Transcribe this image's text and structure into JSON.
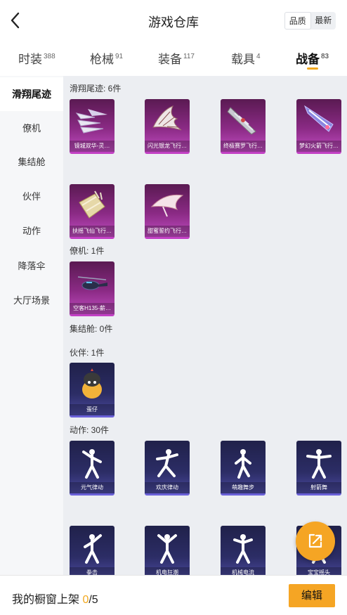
{
  "header": {
    "title": "游戏仓库",
    "sort_options": [
      "品质",
      "最新"
    ]
  },
  "tabs": [
    {
      "label": "时装",
      "count": "388"
    },
    {
      "label": "枪械",
      "count": "91"
    },
    {
      "label": "装备",
      "count": "117"
    },
    {
      "label": "载具",
      "count": "4"
    },
    {
      "label": "战备",
      "count": "83"
    }
  ],
  "sidebar": {
    "items": [
      "滑翔尾迹",
      "僚机",
      "集结舱",
      "伙伴",
      "动作",
      "降落伞",
      "大厅场景"
    ]
  },
  "sections": {
    "glide": {
      "label": "滑翔尾迹: 6件",
      "items": [
        "镜城双华-灵…",
        "闪光银龙飞行…",
        "终极赛罗飞行…",
        "梦幻火箭飞行…",
        "扶摇飞仙飞行…",
        "甜蜜誓约飞行…"
      ]
    },
    "wingman": {
      "label": "僚机: 1件",
      "items": [
        "空客H135-薪…"
      ]
    },
    "capsule": {
      "label": "集结舱: 0件"
    },
    "partner": {
      "label": "伙伴: 1件",
      "items": [
        "蛋仔"
      ]
    },
    "emote": {
      "label": "动作: 30件",
      "items": [
        "元气律动",
        "欢庆律动",
        "萌趣舞步",
        "射箭舞",
        "拳击",
        "机电狂潮",
        "机械电流",
        "宝宝摇头"
      ]
    }
  },
  "footer": {
    "prefix": "我的橱窗上架 ",
    "current": "0",
    "total": "/5",
    "edit_label": "编辑"
  },
  "colors": {
    "accent": "#f5a524",
    "rare_pink": "#c240c4",
    "rare_blue": "#6a60d8"
  }
}
